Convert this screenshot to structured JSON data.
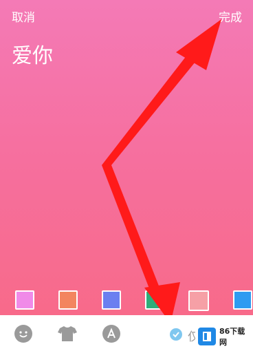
{
  "header": {
    "cancel_label": "取消",
    "done_label": "完成"
  },
  "editor": {
    "text": "爱你"
  },
  "swatches": [
    {
      "color": "#f08ae8"
    },
    {
      "color": "#f3855f"
    },
    {
      "color": "#6b7ff0"
    },
    {
      "color": "#2ead7a"
    },
    {
      "color": "#f6a0a6"
    },
    {
      "color": "#2e9bf1"
    }
  ],
  "toolbar": {
    "tools": [
      "sticker-icon",
      "tshirt-icon",
      "font-icon"
    ],
    "option_label": "仅"
  },
  "watermark": {
    "text": "86下载网"
  },
  "colors": {
    "background_top": "#f47ab6",
    "background_bottom": "#f86985",
    "arrow": "#ff1a1a",
    "check": "#7fc7ef"
  }
}
